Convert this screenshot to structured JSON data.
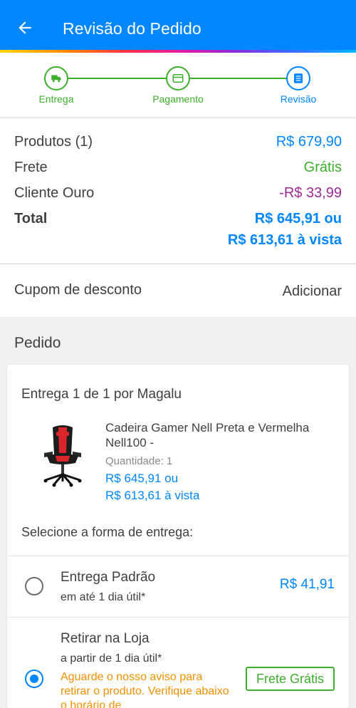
{
  "header": {
    "title": "Revisão do Pedido"
  },
  "stepper": {
    "steps": [
      {
        "label": "Entrega",
        "icon": "truck-icon",
        "state": "done"
      },
      {
        "label": "Pagamento",
        "icon": "card-icon",
        "state": "done"
      },
      {
        "label": "Revisão",
        "icon": "list-icon",
        "state": "current"
      }
    ]
  },
  "summary": {
    "products_label": "Produtos (1)",
    "products_value": "R$ 679,90",
    "shipping_label": "Frete",
    "shipping_value": "Grátis",
    "gold_label": "Cliente Ouro",
    "gold_value": "-R$ 33,99",
    "total_label": "Total",
    "total_value": "R$ 645,91 ou",
    "total_cash": "R$ 613,61 à vista"
  },
  "coupon": {
    "label": "Cupom de desconto",
    "action": "Adicionar"
  },
  "order": {
    "section_title": "Pedido",
    "delivery_title": "Entrega 1 de 1 por Magalu",
    "product": {
      "name": "Cadeira Gamer Nell Preta e Vermelha Nell100 -",
      "quantity": "Quantidade:  1",
      "price": "R$ 645,91 ou",
      "price_cash": "R$ 613,61 à vista"
    },
    "select_title": "Selecione a forma de entrega:",
    "options": [
      {
        "title": "Entrega Padrão",
        "subtitle": "em até 1 dia útil*",
        "price": "R$ 41,91",
        "selected": false
      },
      {
        "title": "Retirar na Loja",
        "subtitle": "a partir de 1 dia útil*",
        "warning": "Aguarde o nosso aviso para retirar o produto. Verifique abaixo o horário de",
        "badge": "Frete Grátis",
        "selected": true
      }
    ]
  },
  "colors": {
    "primary": "#0086ff",
    "success": "#3dae2b",
    "discount": "#9e2a94",
    "warning": "#f29100"
  }
}
